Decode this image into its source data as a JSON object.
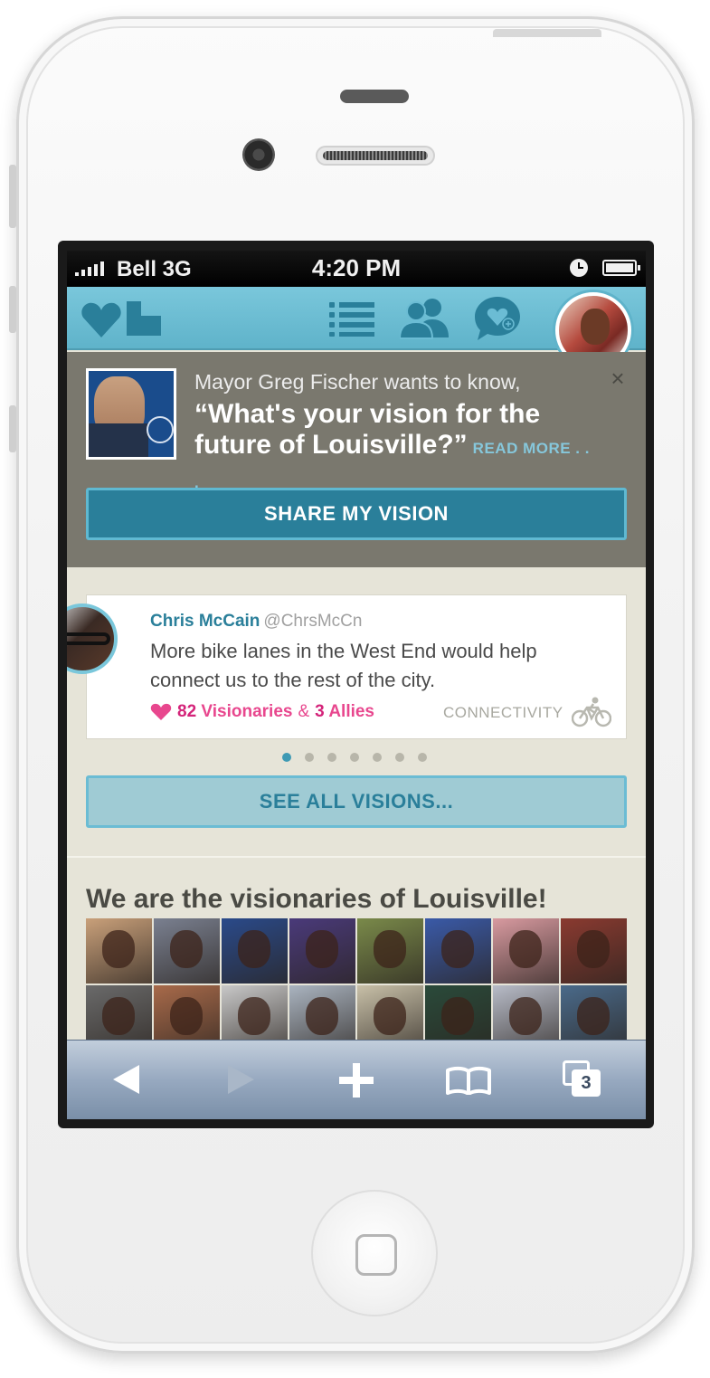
{
  "status_bar": {
    "carrier": "Bell 3G",
    "time": "4:20 PM"
  },
  "nav": {
    "icons": [
      "logo-icon",
      "list-icon",
      "people-icon",
      "chat-heart-icon",
      "user-avatar"
    ]
  },
  "mayor": {
    "intro": "Mayor Greg Fischer wants to know,",
    "question": "“What's your vision for the future of Louisville?”",
    "read_more": "READ MORE . . .",
    "close": "×",
    "share_button": "SHARE MY VISION"
  },
  "vision": {
    "name": "Chris McCain",
    "handle": "@ChrsMcCn",
    "text": "More bike lanes in the West End would help connect us to the rest of the city.",
    "visionaries_count": "82",
    "visionaries_label": "Visionaries",
    "ampersand": "&",
    "allies_count": "3",
    "allies_label": "Allies",
    "category": "CONNECTIVITY"
  },
  "pagination": {
    "total": 7,
    "active": 0
  },
  "see_all_button": "SEE ALL VISIONS...",
  "visionaries_title": "We are the visionaries of Louisville!",
  "grid_colors": [
    "#c9a07a",
    "#7a8090",
    "#2a4a8a",
    "#4a3a7a",
    "#7a8a4a",
    "#3a5aa8",
    "#d89aa0",
    "#8a3a30",
    "#6a6a6a",
    "#a86a4a",
    "#c8c8c8",
    "#aab4c0",
    "#c8c0a8",
    "#2a4a3a",
    "#b8bcc8",
    "#4a6a8a"
  ],
  "toolbar": {
    "tabs_count": "3"
  },
  "colors": {
    "accent": "#2a7f9a",
    "nav": "#6bbcd4",
    "pink": "#e8478e"
  }
}
